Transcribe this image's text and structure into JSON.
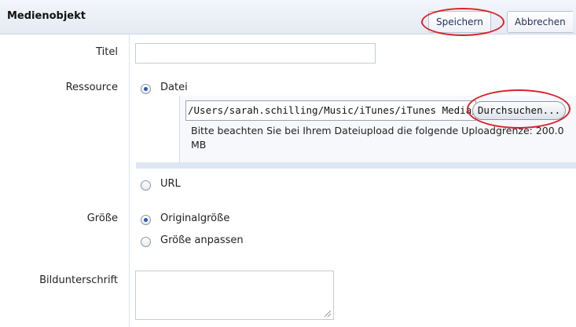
{
  "header": {
    "title": "Medienobjekt",
    "save_label": "Speichern",
    "cancel_label": "Abbrechen"
  },
  "fields": {
    "title_label": "Titel",
    "title_value": "",
    "resource_label": "Ressource",
    "resource_options": {
      "file": "Datei",
      "url": "URL",
      "selected": "Datei"
    },
    "file_path": "/Users/sarah.schilling/Music/iTunes/iTunes Media/M",
    "browse_label": "Durchsuchen...",
    "upload_note": "Bitte beachten Sie bei Ihrem Dateiupload die folgende Uploadgrenze: 200.0 MB",
    "size_label": "Größe",
    "size_options": {
      "original": "Originalgröße",
      "custom": "Größe anpassen",
      "selected": "Originalgröße"
    },
    "caption_label": "Bildunterschrift",
    "caption_value": ""
  },
  "annotations": {
    "highlight_color": "#d8232a"
  }
}
